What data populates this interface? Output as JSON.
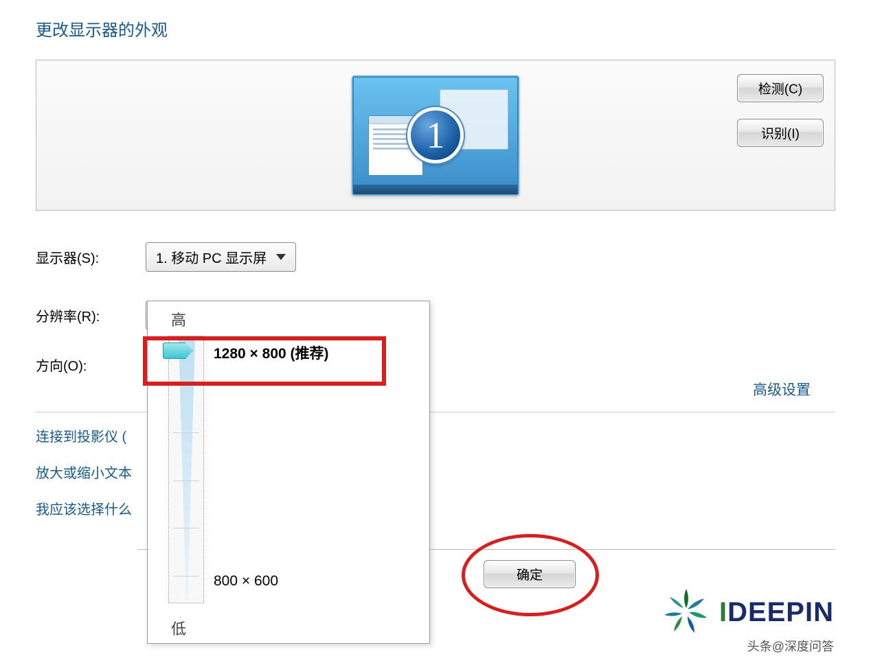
{
  "pageTitle": "更改显示器的外观",
  "monitorPreview": {
    "number": "1"
  },
  "buttons": {
    "detect": "检测(C)",
    "identify": "识别(I)",
    "ok": "确定"
  },
  "fields": {
    "display": {
      "label": "显示器(S):",
      "value": "1. 移动 PC 显示屏"
    },
    "resolution": {
      "label": "分辨率(R):",
      "value": "1280 × 800 (推荐)"
    },
    "orientation": {
      "label": "方向(O):"
    }
  },
  "slider": {
    "highLabel": "高",
    "lowLabel": "低",
    "topOption": "1280 × 800 (推荐)",
    "bottomOption": "800 × 600"
  },
  "links": {
    "advanced": "高级设置",
    "projector": "连接到投影仪 (",
    "textSize": "放大或缩小文本",
    "whichChoose": "我应该选择什么"
  },
  "watermark": {
    "brand_i": "I",
    "brand_rest": "DEEPIN",
    "subtitle": "头条@深度问答"
  }
}
